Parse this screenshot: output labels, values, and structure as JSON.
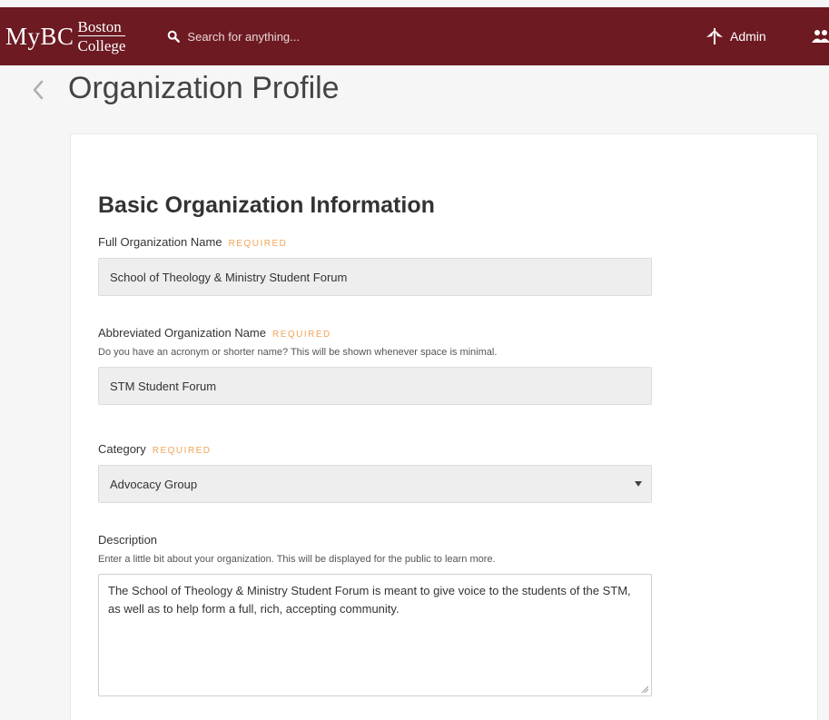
{
  "topbar": {
    "logo_mybc": "MyBC",
    "logo_line1": "Boston",
    "logo_line2": "College",
    "search_placeholder": "Search for anything...",
    "admin_label": "Admin",
    "bg_color": "#6d1a22"
  },
  "page": {
    "title": "Organization Profile"
  },
  "form": {
    "section_title": "Basic Organization Information",
    "required_label": "REQUIRED",
    "full_name": {
      "label": "Full Organization Name",
      "value": "School of Theology & Ministry Student Forum"
    },
    "abbrev_name": {
      "label": "Abbreviated Organization Name",
      "help": "Do you have an acronym or shorter name? This will be shown whenever space is minimal.",
      "value": "STM Student Forum"
    },
    "category": {
      "label": "Category",
      "selected": "Advocacy Group"
    },
    "description": {
      "label": "Description",
      "help": "Enter a little bit about your organization. This will be displayed for the public to learn more.",
      "value": "The School of Theology & Ministry Student Forum is meant to give voice to the students of the STM, as well as to help form a full, rich, accepting community."
    }
  },
  "colors": {
    "accent": "#6d1a22",
    "required": "#f0a457"
  },
  "icons": [
    "search-icon",
    "admin-icon",
    "groups-icon",
    "back-chevron-icon",
    "chevron-down-icon",
    "resize-grip-icon"
  ]
}
